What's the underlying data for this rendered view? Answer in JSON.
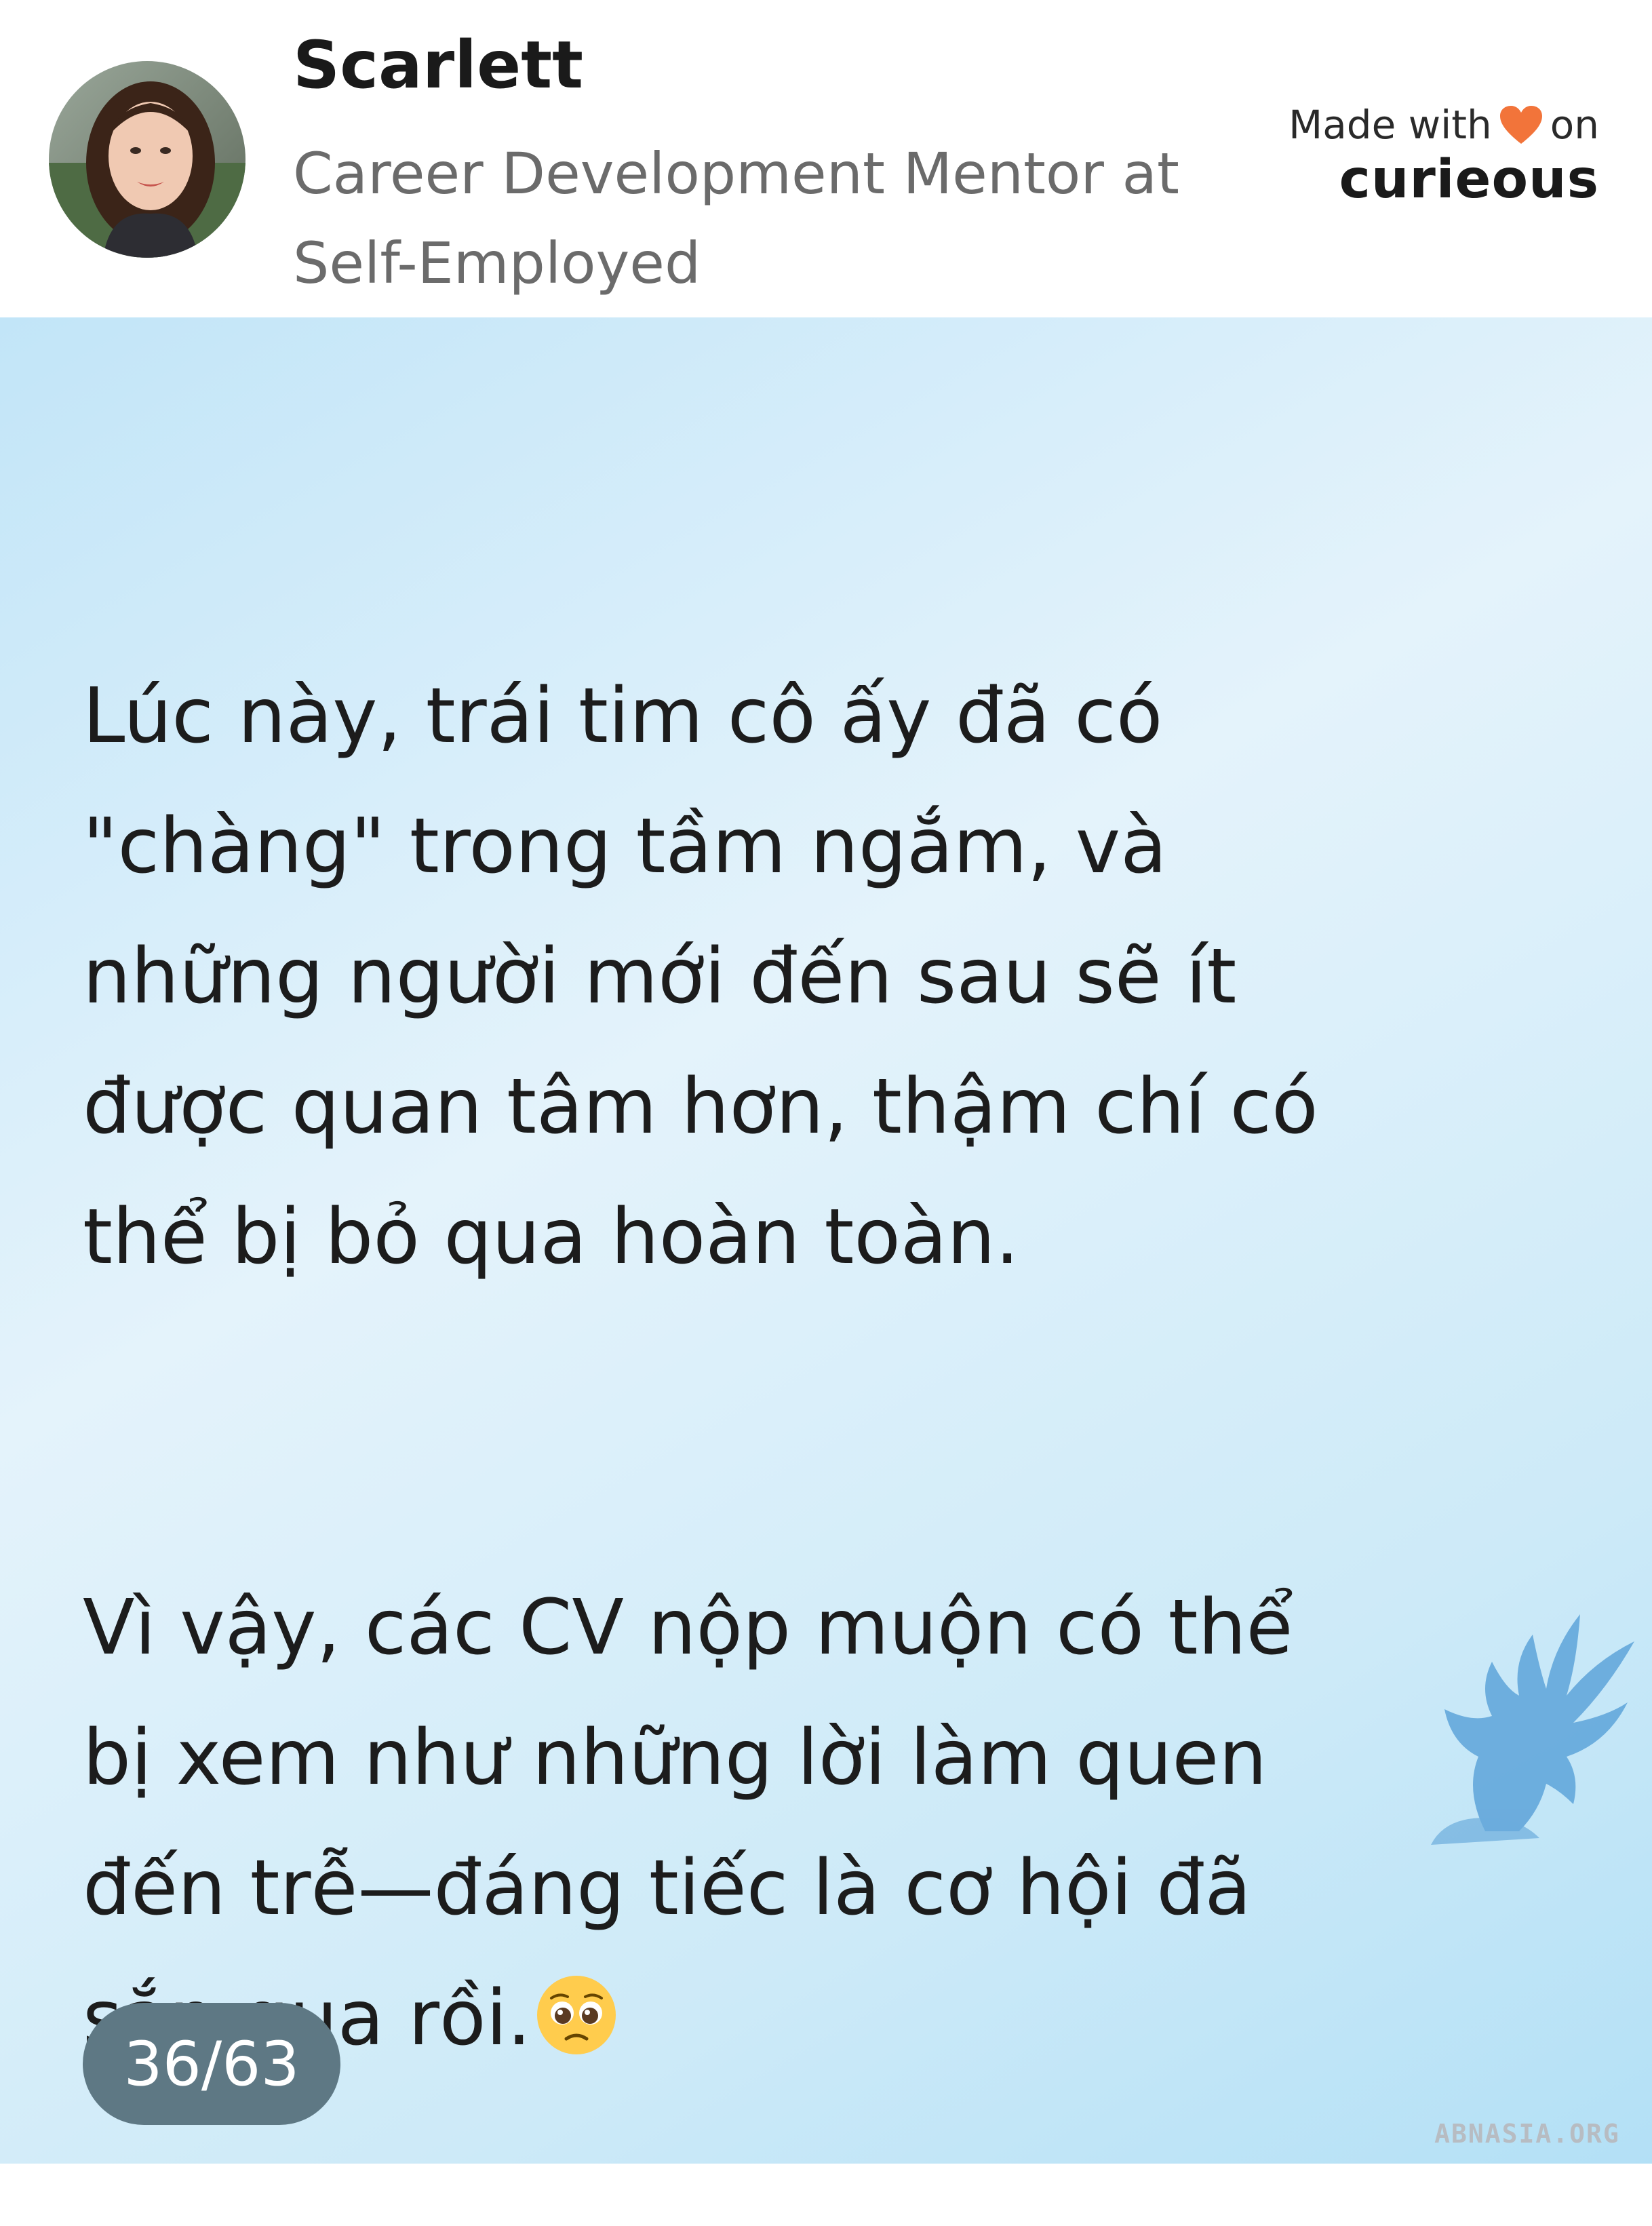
{
  "author": {
    "name": "Scarlett",
    "title": "Career Development Mentor at Self-Employed"
  },
  "brand": {
    "made_with": "Made with",
    "on": "on",
    "name": "curieous",
    "heart_color": "#F2743A"
  },
  "post": {
    "paragraph_1": "Lúc này, trái tim cô ấy đã có\n\"chàng\" trong tầm ngắm, và\nnhững người mới đến sau sẽ ít\nđược quan tâm hơn, thậm chí có\nthể bị bỏ qua hoàn toàn.",
    "paragraph_2": "Vì vậy, các CV nộp muộn có thể\nbị xem như những lời làm quen\nđến trễ—đáng tiếc là cơ hội đã\nsắp qua rồi.",
    "emoji": "pleading-face",
    "background_colors": [
      "#C2E5F8",
      "#E4F3FB",
      "#B3E0F6"
    ]
  },
  "pagination": {
    "label": "36/63"
  },
  "watermark": {
    "text": "ABNASIA.ORG",
    "icon": "griffin-logo-icon",
    "color": "#5DA3D9"
  }
}
